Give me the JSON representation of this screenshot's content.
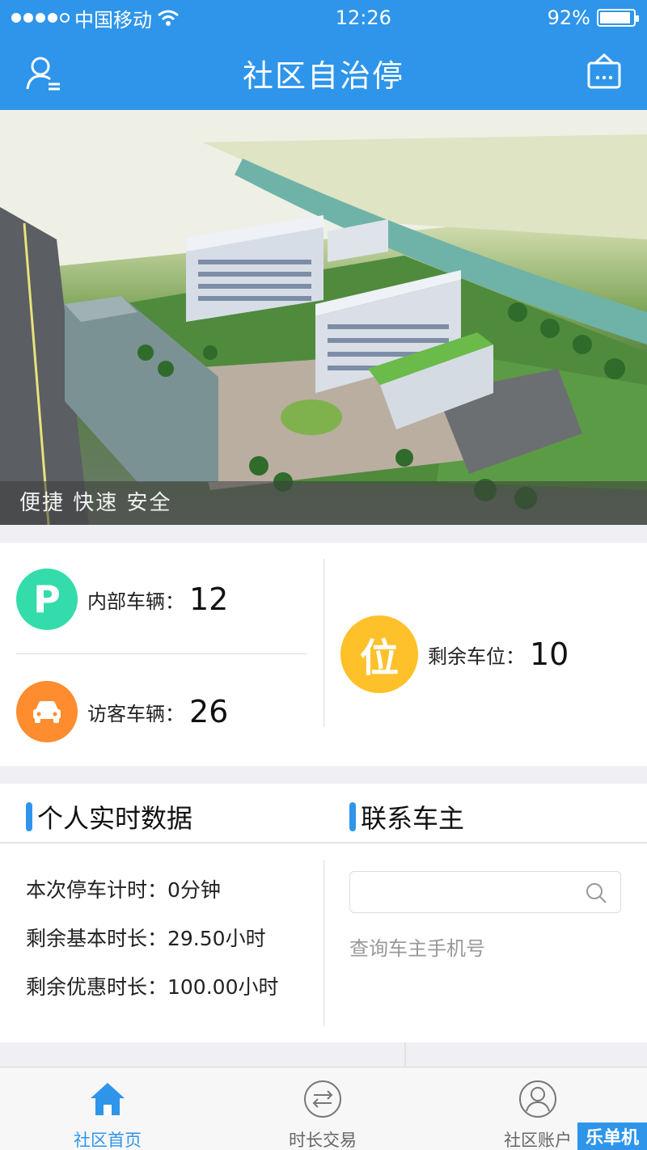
{
  "status_bar": {
    "carrier": "中国移动",
    "time": "12:26",
    "battery": "92%",
    "battery_level": 0.92,
    "signal_icon": "signal-dots-icon",
    "wifi_icon": "wifi-icon"
  },
  "nav": {
    "title": "社区自治停",
    "left_icon": "user-list-icon",
    "right_icon": "shop-icon"
  },
  "banner": {
    "caption": "便捷 快速 安全"
  },
  "stats": {
    "internal": {
      "label": "内部车辆：",
      "value": "12",
      "icon": "P",
      "color": "#33dcaa"
    },
    "visitor": {
      "label": "访客车辆：",
      "value": "26",
      "icon": "car-icon",
      "color": "#ff8c2e"
    },
    "remaining": {
      "label": "剩余车位：",
      "value": "10",
      "icon": "位",
      "color": "#ffc12a"
    }
  },
  "realtime": {
    "title": "个人实时数据",
    "lines": [
      "本次停车计时：0分钟",
      "剩余基本时长：29.50小时",
      "剩余优惠时长：100.00小时"
    ]
  },
  "contact": {
    "title": "联系车主",
    "search_placeholder": "",
    "hint": "查询车主手机号"
  },
  "tabs": [
    {
      "label": "社区首页",
      "icon": "home-icon",
      "active": true
    },
    {
      "label": "时长交易",
      "icon": "exchange-icon",
      "active": false
    },
    {
      "label": "社区账户",
      "icon": "account-icon",
      "active": false
    }
  ],
  "watermark": "乐单机",
  "colors": {
    "primary": "#2e95ea",
    "background": "#efeff4"
  }
}
